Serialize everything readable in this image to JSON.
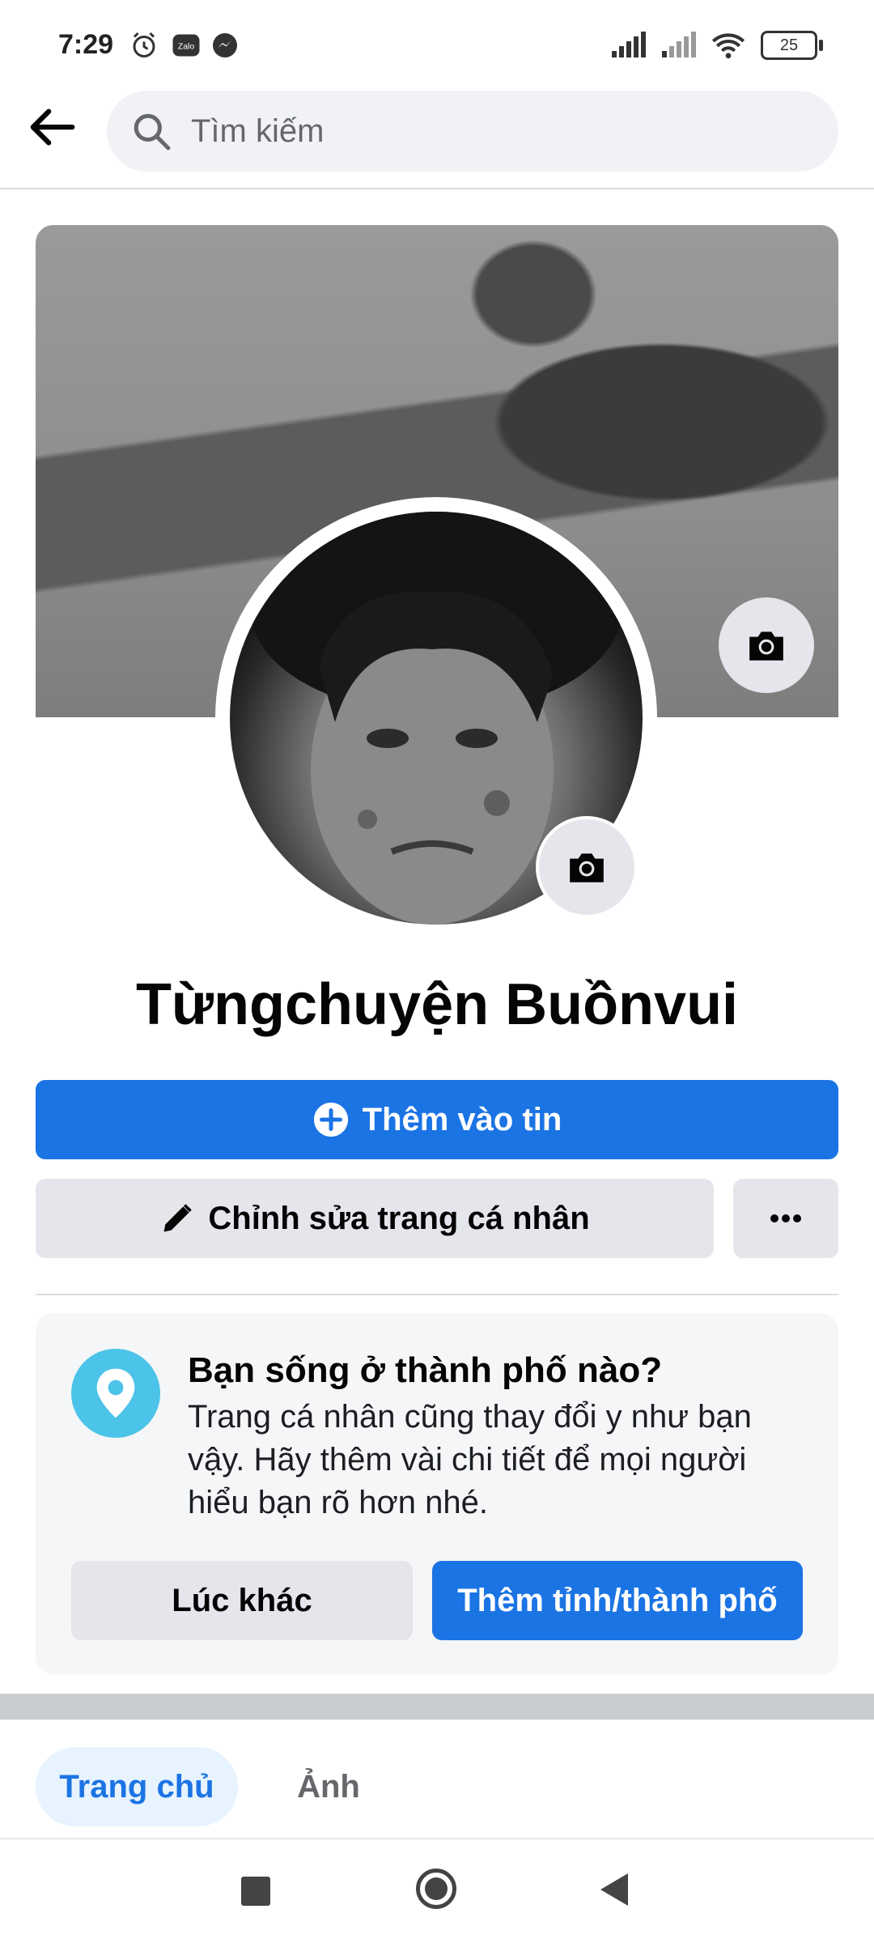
{
  "status_bar": {
    "time": "7:29",
    "battery": "25"
  },
  "search": {
    "placeholder": "Tìm kiếm"
  },
  "profile": {
    "name": "Từngchuyện Buồnvui"
  },
  "actions": {
    "add_story": "Thêm vào tin",
    "edit_profile": "Chỉnh sửa trang cá nhân"
  },
  "city_card": {
    "title": "Bạn sống ở thành phố nào?",
    "description": "Trang cá nhân cũng thay đổi y như bạn vậy. Hãy thêm vài chi tiết để mọi người hiểu bạn rõ hơn nhé.",
    "later_button": "Lúc khác",
    "add_city_button": "Thêm tỉnh/thành phố"
  },
  "tabs": [
    {
      "label": "Trang chủ",
      "active": true
    },
    {
      "label": "Ảnh",
      "active": false
    }
  ],
  "colors": {
    "primary": "#1b74e4",
    "pin": "#4cc3e8",
    "secondary_button": "#e4e6eb"
  }
}
